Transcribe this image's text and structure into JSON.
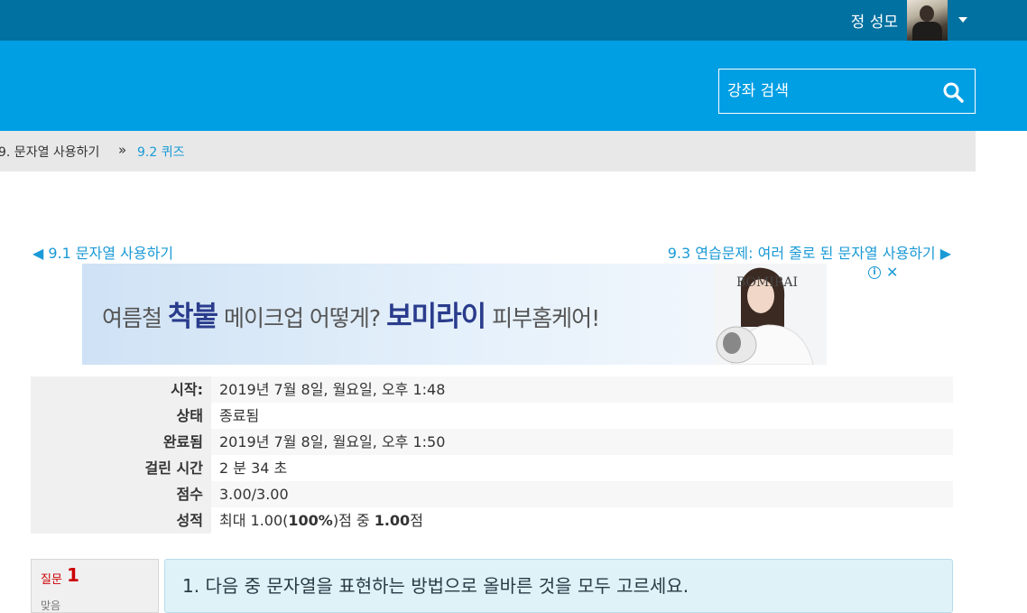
{
  "topbar": {
    "user_name": "정 성모"
  },
  "header": {
    "search_placeholder": "강좌 검색"
  },
  "breadcrumb": {
    "items": [
      "9. 문자열 사용하기",
      "9.2 퀴즈"
    ],
    "separator": "»"
  },
  "nav": {
    "prev_label": "◀ 9.1 문자열 사용하기",
    "next_label": "9.3 연습문제: 여러 줄로 된 문자열 사용하기 ▶"
  },
  "ad": {
    "text_prefix": "여름철 ",
    "text_emph": "착붙",
    "text_mid": " 메이크업 어떻게? ",
    "text_brand": "보미라이",
    "text_suffix": " 피부홈케어!",
    "brand_logo": "BOMIRAI",
    "info_label": "i",
    "close_label": "✕"
  },
  "summary": [
    {
      "key": "시작:",
      "value": "2019년 7월 8일, 월요일, 오후 1:48"
    },
    {
      "key": "상태",
      "value": "종료됨"
    },
    {
      "key": "완료됨",
      "value": "2019년 7월 8일, 월요일, 오후 1:50"
    },
    {
      "key": "걸린 시간",
      "value": "2 분 34 초"
    },
    {
      "key": "점수",
      "value": "3.00/3.00"
    },
    {
      "key": "성적",
      "value": "최대 1.00(100%)점 중 1.00점"
    }
  ],
  "question": {
    "label": "질문",
    "number": "1",
    "status": "맞음",
    "text": "1. 다음 중 문자열을 표현하는 방법으로 올바른 것을 모두 고르세요."
  },
  "colors": {
    "topbar": "#0071a1",
    "header": "#009ee3",
    "link": "#1a9ad6",
    "question_box": "#def2f8"
  }
}
